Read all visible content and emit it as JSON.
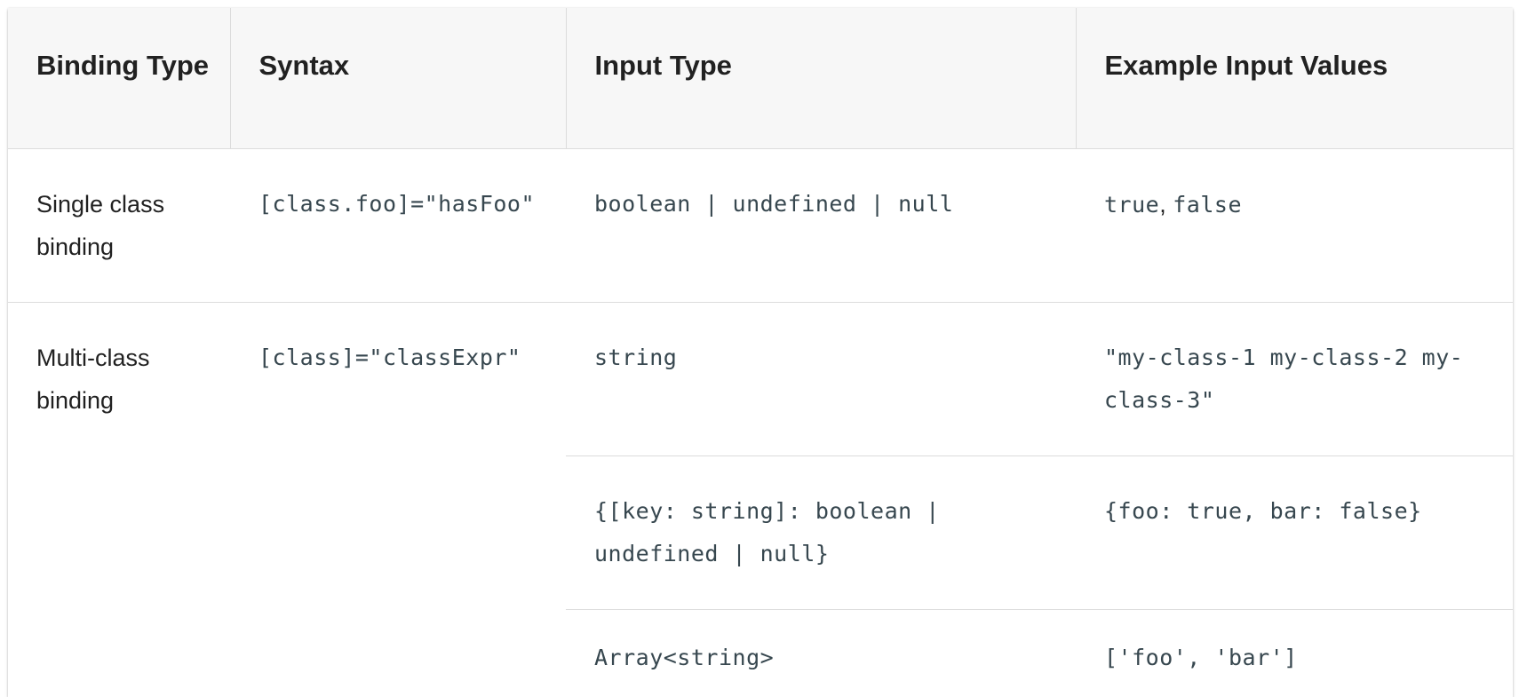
{
  "table": {
    "headers": [
      "Binding Type",
      "Syntax",
      "Input Type",
      "Example Input Values"
    ],
    "rows": [
      {
        "binding_type": "Single class binding",
        "syntax": "[class.foo]=\"hasFoo\"",
        "input_type": "boolean | undefined | null",
        "example_a": "true",
        "example_sep": ", ",
        "example_b": "false"
      },
      {
        "binding_type": "Multi-class binding",
        "syntax": "[class]=\"classExpr\"",
        "input_type": "string",
        "example": "\"my-class-1 my-class-2 my-class-3\""
      },
      {
        "input_type": "{[key: string]: boolean | undefined | null}",
        "example": "{foo: true, bar: false}"
      },
      {
        "input_type": "Array<string>",
        "example": "['foo', 'bar']"
      }
    ]
  }
}
